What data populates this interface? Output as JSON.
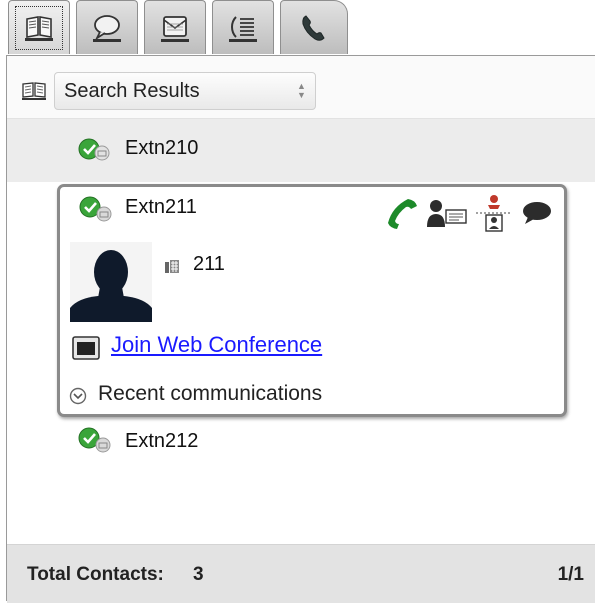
{
  "tabs": [
    {
      "icon": "address-book-icon",
      "active": true
    },
    {
      "icon": "chat-bubble-icon",
      "active": false
    },
    {
      "icon": "voicemail-icon",
      "active": false
    },
    {
      "icon": "call-log-icon",
      "active": false
    },
    {
      "icon": "phone-icon",
      "active": false
    }
  ],
  "toolbar": {
    "icon": "address-book-icon",
    "dropdown_value": "Search Results"
  },
  "contacts": [
    {
      "name": "Extn210",
      "presence": "available"
    },
    {
      "name": "Extn211",
      "presence": "available-mobile",
      "expanded": true,
      "extension": "211",
      "web_conference_label": "Join Web Conference",
      "recent_label": "Recent communications",
      "actions": [
        "call-icon",
        "contact-card-icon",
        "transfer-icon",
        "chat-icon"
      ]
    },
    {
      "name": "Extn212",
      "presence": "available-mobile"
    }
  ],
  "footer": {
    "total_label": "Total Contacts:",
    "total_count": "3",
    "page": "1/1"
  },
  "colors": {
    "presence_green": "#3aa53a",
    "call_green": "#1d8a2a",
    "link_blue": "#1a1aff"
  }
}
